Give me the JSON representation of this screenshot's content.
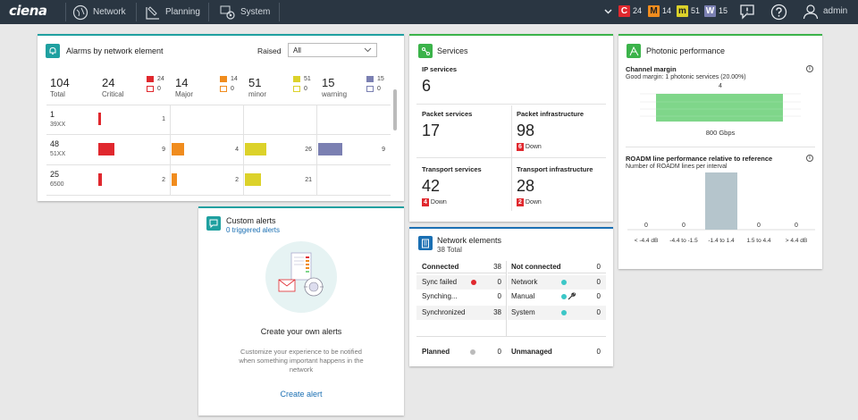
{
  "topbar": {
    "brand": "ciena",
    "nav": [
      {
        "label": "Network",
        "icon": "network-globe-icon"
      },
      {
        "label": "Planning",
        "icon": "planning-icon"
      },
      {
        "label": "System",
        "icon": "system-gear-icon"
      }
    ],
    "alarm_badges": [
      {
        "letter": "C",
        "count": "24",
        "color": "#e0282e"
      },
      {
        "letter": "M",
        "count": "14",
        "color": "#f08c1e"
      },
      {
        "letter": "m",
        "count": "51",
        "color": "#dcd22a"
      },
      {
        "letter": "W",
        "count": "15",
        "color": "#7b80b2"
      }
    ],
    "user": "admin"
  },
  "alarms": {
    "title": "Alarms by network element",
    "filter_label": "Raised",
    "filter_value": "All",
    "summary": [
      {
        "count": "104",
        "label": "Total"
      },
      {
        "count": "24",
        "label": "Critical",
        "raised": "24",
        "cleared": "0"
      },
      {
        "count": "14",
        "label": "Major",
        "raised": "14",
        "cleared": "0"
      },
      {
        "count": "51",
        "label": "minor",
        "raised": "51",
        "cleared": "0"
      },
      {
        "count": "15",
        "label": "warning",
        "raised": "15",
        "cleared": "0"
      }
    ],
    "rows": [
      {
        "count": "1",
        "type": "39XX",
        "critical": "1",
        "major": "",
        "minor": "",
        "warning": ""
      },
      {
        "count": "48",
        "type": "51XX",
        "critical": "9",
        "major": "4",
        "minor": "26",
        "warning": "9"
      },
      {
        "count": "25",
        "type": "6500",
        "critical": "2",
        "major": "2",
        "minor": "21",
        "warning": ""
      }
    ]
  },
  "services": {
    "title": "Services",
    "ip_label": "IP services",
    "ip_count": "6",
    "packet_label": "Packet services",
    "packet_count": "17",
    "packet_infra_label": "Packet infrastructure",
    "packet_infra_count": "98",
    "packet_infra_down": "6",
    "transport_label": "Transport services",
    "transport_count": "42",
    "transport_down": "4",
    "transport_infra_label": "Transport infrastructure",
    "transport_infra_count": "28",
    "transport_infra_down": "2",
    "down_label": "Down"
  },
  "photonic": {
    "title": "Photonic performance",
    "margin_title": "Channel margin",
    "margin_sub": "Good margin: 1 photonic services (20.00%)",
    "margin_value": "4",
    "margin_axis": "800 Gbps",
    "roadm_title": "ROADM line performance relative to reference",
    "roadm_sub": "Number of ROADM lines per interval",
    "chart_data": {
      "type": "bar",
      "categories": [
        "< -4.4 dB",
        "-4.4 to -1.5",
        "-1.4 to 1.4",
        "1.5 to 4.4",
        "> 4.4 dB"
      ],
      "values": [
        0,
        0,
        3,
        0,
        0
      ],
      "title": "ROADM line performance relative to reference",
      "ylabel": "Number of ROADM lines per interval",
      "bar_color": "#b5c5cc"
    }
  },
  "custom_alerts": {
    "title": "Custom alerts",
    "subtitle": "0 triggered alerts",
    "heading": "Create your own alerts",
    "description": "Customize your experience to be notified when something important happens in the network",
    "action": "Create alert"
  },
  "network_elements": {
    "title": "Network elements",
    "total": "38 Total",
    "connected_label": "Connected",
    "connected": "38",
    "not_connected_label": "Not connected",
    "not_connected": "0",
    "sync_failed_label": "Sync failed",
    "sync_failed": "0",
    "synching_label": "Synching...",
    "synching": "0",
    "synchronized_label": "Synchronized",
    "synchronized": "38",
    "network_label": "Network",
    "network": "0",
    "manual_label": "Manual",
    "manual": "0",
    "system_label": "System",
    "system": "0",
    "planned_label": "Planned",
    "planned": "0",
    "unmanaged_label": "Unmanaged",
    "unmanaged": "0"
  }
}
